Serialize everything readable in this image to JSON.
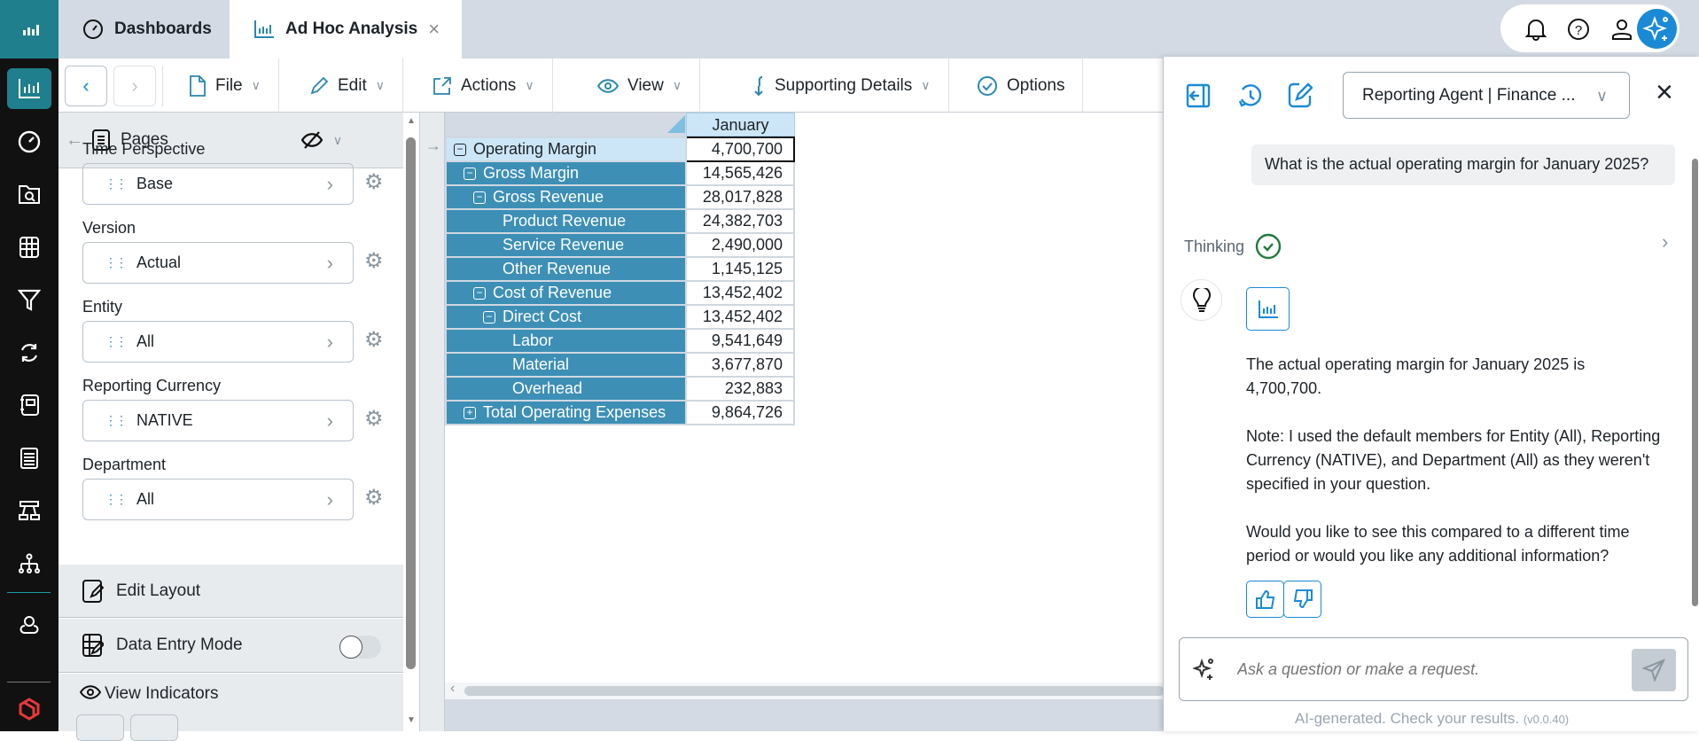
{
  "tabs": {
    "dashboards": "Dashboards",
    "adhoc": "Ad Hoc Analysis"
  },
  "toolbar": {
    "file": "File",
    "edit": "Edit",
    "actions": "Actions",
    "view": "View",
    "supporting": "Supporting Details",
    "options": "Options"
  },
  "left_panel": {
    "title": "Pages",
    "fields": [
      {
        "label": "Time Perspective",
        "value": "Base"
      },
      {
        "label": "Version",
        "value": "Actual"
      },
      {
        "label": "Entity",
        "value": "All"
      },
      {
        "label": "Reporting Currency",
        "value": "NATIVE"
      },
      {
        "label": "Department",
        "value": "All"
      }
    ],
    "edit_layout": "Edit Layout",
    "data_entry": "Data Entry Mode",
    "data_entry_on": false,
    "view_indicators": "View Indicators"
  },
  "grid": {
    "column": "January",
    "rows": [
      {
        "label": "Operating Margin",
        "value": "4,700,700",
        "toggle": "−"
      },
      {
        "label": "Gross Margin",
        "value": "14,565,426",
        "toggle": "−"
      },
      {
        "label": "Gross Revenue",
        "value": "28,017,828",
        "toggle": "−"
      },
      {
        "label": "Product Revenue",
        "value": "24,382,703"
      },
      {
        "label": "Service Revenue",
        "value": "2,490,000"
      },
      {
        "label": "Other Revenue",
        "value": "1,145,125"
      },
      {
        "label": "Cost of Revenue",
        "value": "13,452,402",
        "toggle": "−"
      },
      {
        "label": "Direct Cost",
        "value": "13,452,402",
        "toggle": "−"
      },
      {
        "label": "Labor",
        "value": "9,541,649"
      },
      {
        "label": "Material",
        "value": "3,677,870"
      },
      {
        "label": "Overhead",
        "value": "232,883"
      },
      {
        "label": "Total Operating Expenses",
        "value": "9,864,726",
        "toggle": "+"
      }
    ]
  },
  "chat": {
    "agent": "Reporting Agent | Finance ...",
    "question": "What is the actual operating margin for January 2025?",
    "thinking": "Thinking",
    "answer": [
      "The actual operating margin for January 2025 is 4,700,700.",
      "Note: I used the default members for Entity (All), Reporting Currency (NATIVE), and Department (All) as they weren't specified in your question.",
      "Would you like to see this compared to a different time period or would you like any additional information?"
    ],
    "placeholder": "Ask a question or make a request.",
    "footer": "AI-generated. Check your results.",
    "version": "(v0.0.40)"
  }
}
